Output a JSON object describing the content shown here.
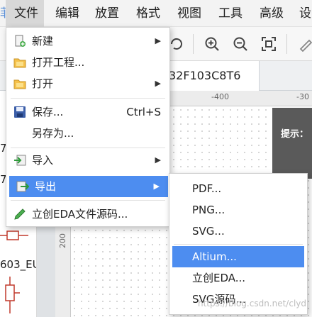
{
  "menubar": {
    "items": [
      "文件",
      "编辑",
      "放置",
      "格式",
      "视图",
      "工具",
      "高级",
      "设"
    ],
    "active_index": 0
  },
  "tab": {
    "label": "32F103C8T6"
  },
  "ruler": {
    "top_labels": [
      "-400",
      "-30"
    ],
    "left_labels": [
      "200"
    ]
  },
  "hint": {
    "text": "提示："
  },
  "left_panel": {
    "texts": [
      "7(",
      "7(",
      "603_EU"
    ]
  },
  "file_menu": {
    "items": [
      {
        "label": "新建",
        "icon": "new-file-icon",
        "has_submenu": true
      },
      {
        "label": "打开工程...",
        "icon": "folder-project-icon"
      },
      {
        "label": "打开",
        "icon": "folder-open-icon",
        "has_submenu": true
      },
      {
        "label": "保存...",
        "icon": "save-icon",
        "shortcut": "Ctrl+S"
      },
      {
        "label": "另存为..."
      },
      {
        "label": "导入",
        "icon": "import-icon",
        "has_submenu": true
      },
      {
        "label": "导出",
        "icon": "export-icon",
        "has_submenu": true,
        "highlighted": true
      },
      {
        "label": "立创EDA文件源码...",
        "icon": "pencil-icon"
      }
    ]
  },
  "export_submenu": {
    "items": [
      {
        "label": "PDF..."
      },
      {
        "label": "PNG..."
      },
      {
        "label": "SVG..."
      },
      {
        "label": "Altium...",
        "highlighted": true
      },
      {
        "label": "立创EDA..."
      },
      {
        "label": "SVG源码..."
      }
    ]
  },
  "watermark": {
    "text": "https://blog.csdn.net/clyd"
  },
  "colors": {
    "highlight": "#4d8df0",
    "hint_bg": "#5a5a5a"
  }
}
